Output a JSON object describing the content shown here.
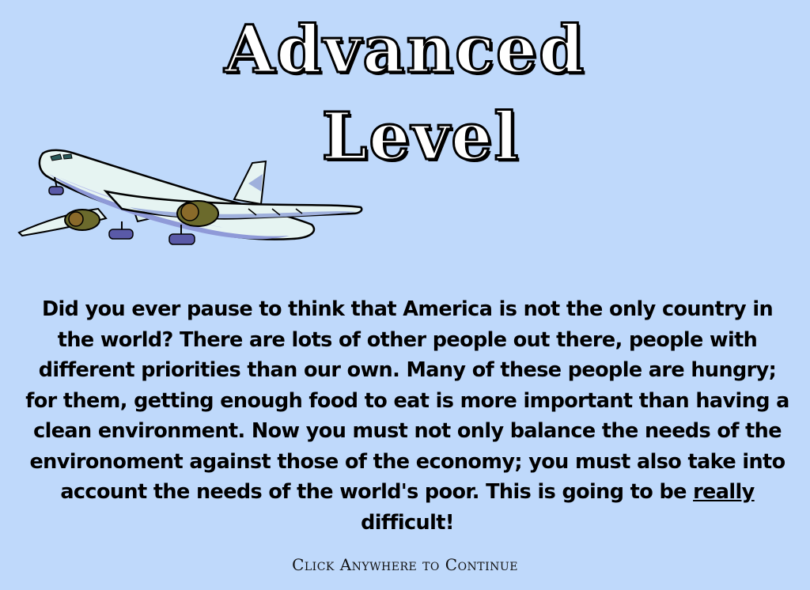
{
  "title": {
    "line1": "Advanced",
    "line2": "Level"
  },
  "intro": {
    "text_before": "Did you ever pause to think that America is not the only country in the world? There are lots of other people out there, people with different priorities than our own. Many of these people are hungry; for them, getting enough food to eat is more important than having a clean environment. Now you must not only balance the needs of the environoment against those of the economy; you must also take into account the needs of the world's poor. This is going to be ",
    "emphasis": "really",
    "text_after": " difficult!"
  },
  "prompt": {
    "continue_label": "Click Anywhere to Continue"
  },
  "illustration": {
    "icon": "airplane-icon"
  },
  "colors": {
    "background": "#bfd9fb",
    "plane_body": "#e6f4f2",
    "plane_shade": "#8f9ad8",
    "engine": "#6b6a2c"
  }
}
